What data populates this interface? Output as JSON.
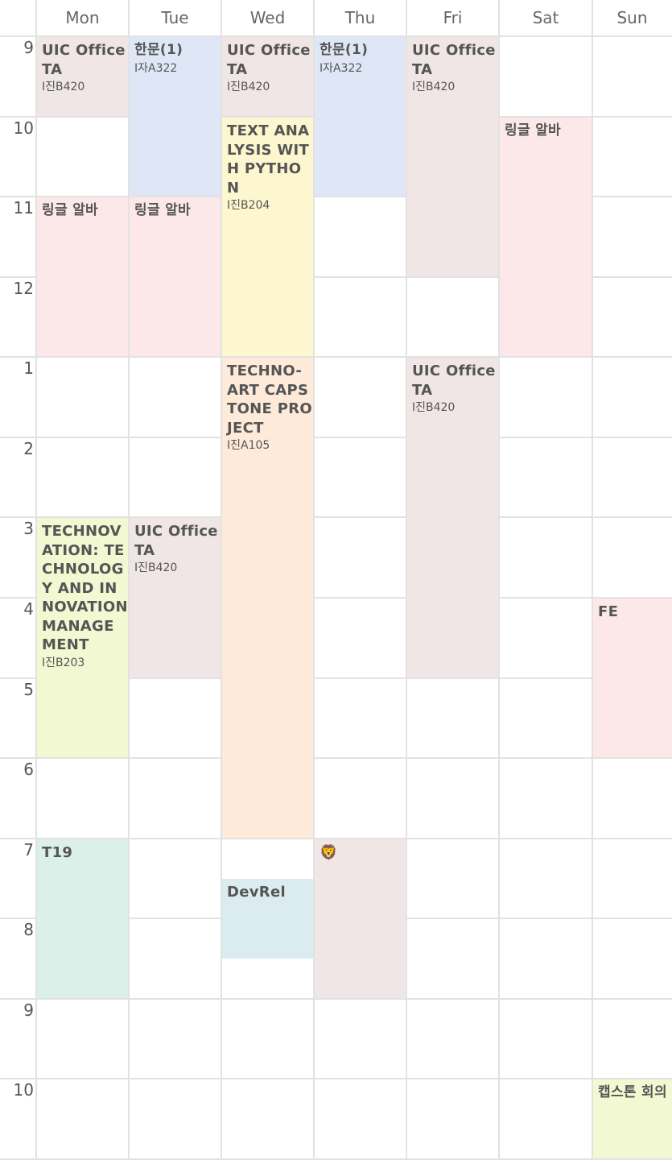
{
  "days": [
    "Mon",
    "Tue",
    "Wed",
    "Thu",
    "Fri",
    "Sat",
    "Sun"
  ],
  "hours": [
    "9",
    "10",
    "11",
    "12",
    "1",
    "2",
    "3",
    "4",
    "5",
    "6",
    "7",
    "8",
    "9",
    "10"
  ],
  "events": [
    {
      "title": "UIC Office TA",
      "room": "I진B420"
    },
    {
      "title": "한문(1)",
      "room": "I자A322"
    },
    {
      "title": "UIC Office TA",
      "room": "I진B420"
    },
    {
      "title": "한문(1)",
      "room": "I자A322"
    },
    {
      "title": "UIC Office TA",
      "room": "I진B420"
    },
    {
      "title": "TEXT ANALYSIS WITH PYTHON",
      "room": "I진B204"
    },
    {
      "title": "링글 알바",
      "room": ""
    },
    {
      "title": "링글 알바",
      "room": ""
    },
    {
      "title": "링글 알바",
      "room": ""
    },
    {
      "title": "TECHNO-ART CAPSTONE PROJECT",
      "room": "I진A105"
    },
    {
      "title": "UIC Office TA",
      "room": "I진B420"
    },
    {
      "title": "TECHNOVATION: TECHNOLOGY AND INNOVATION MANAGEMENT",
      "room": "I진B203"
    },
    {
      "title": "UIC Office TA",
      "room": "I진B420"
    },
    {
      "title": "FE",
      "room": ""
    },
    {
      "title": "T19",
      "room": ""
    },
    {
      "title": "🦁",
      "room": ""
    },
    {
      "title": "DevRel",
      "room": ""
    },
    {
      "title": "캡스톤 회의",
      "room": ""
    }
  ],
  "colors": {
    "pink-gray": "#f1e6e6",
    "blue": "#dfe7f6",
    "pink": "#fde8e9",
    "yellow": "#fdf7cf",
    "peach": "#feead9",
    "lime": "#f2f8d1",
    "mint": "#dbf0e8",
    "lightblue": "#dbecf0"
  }
}
